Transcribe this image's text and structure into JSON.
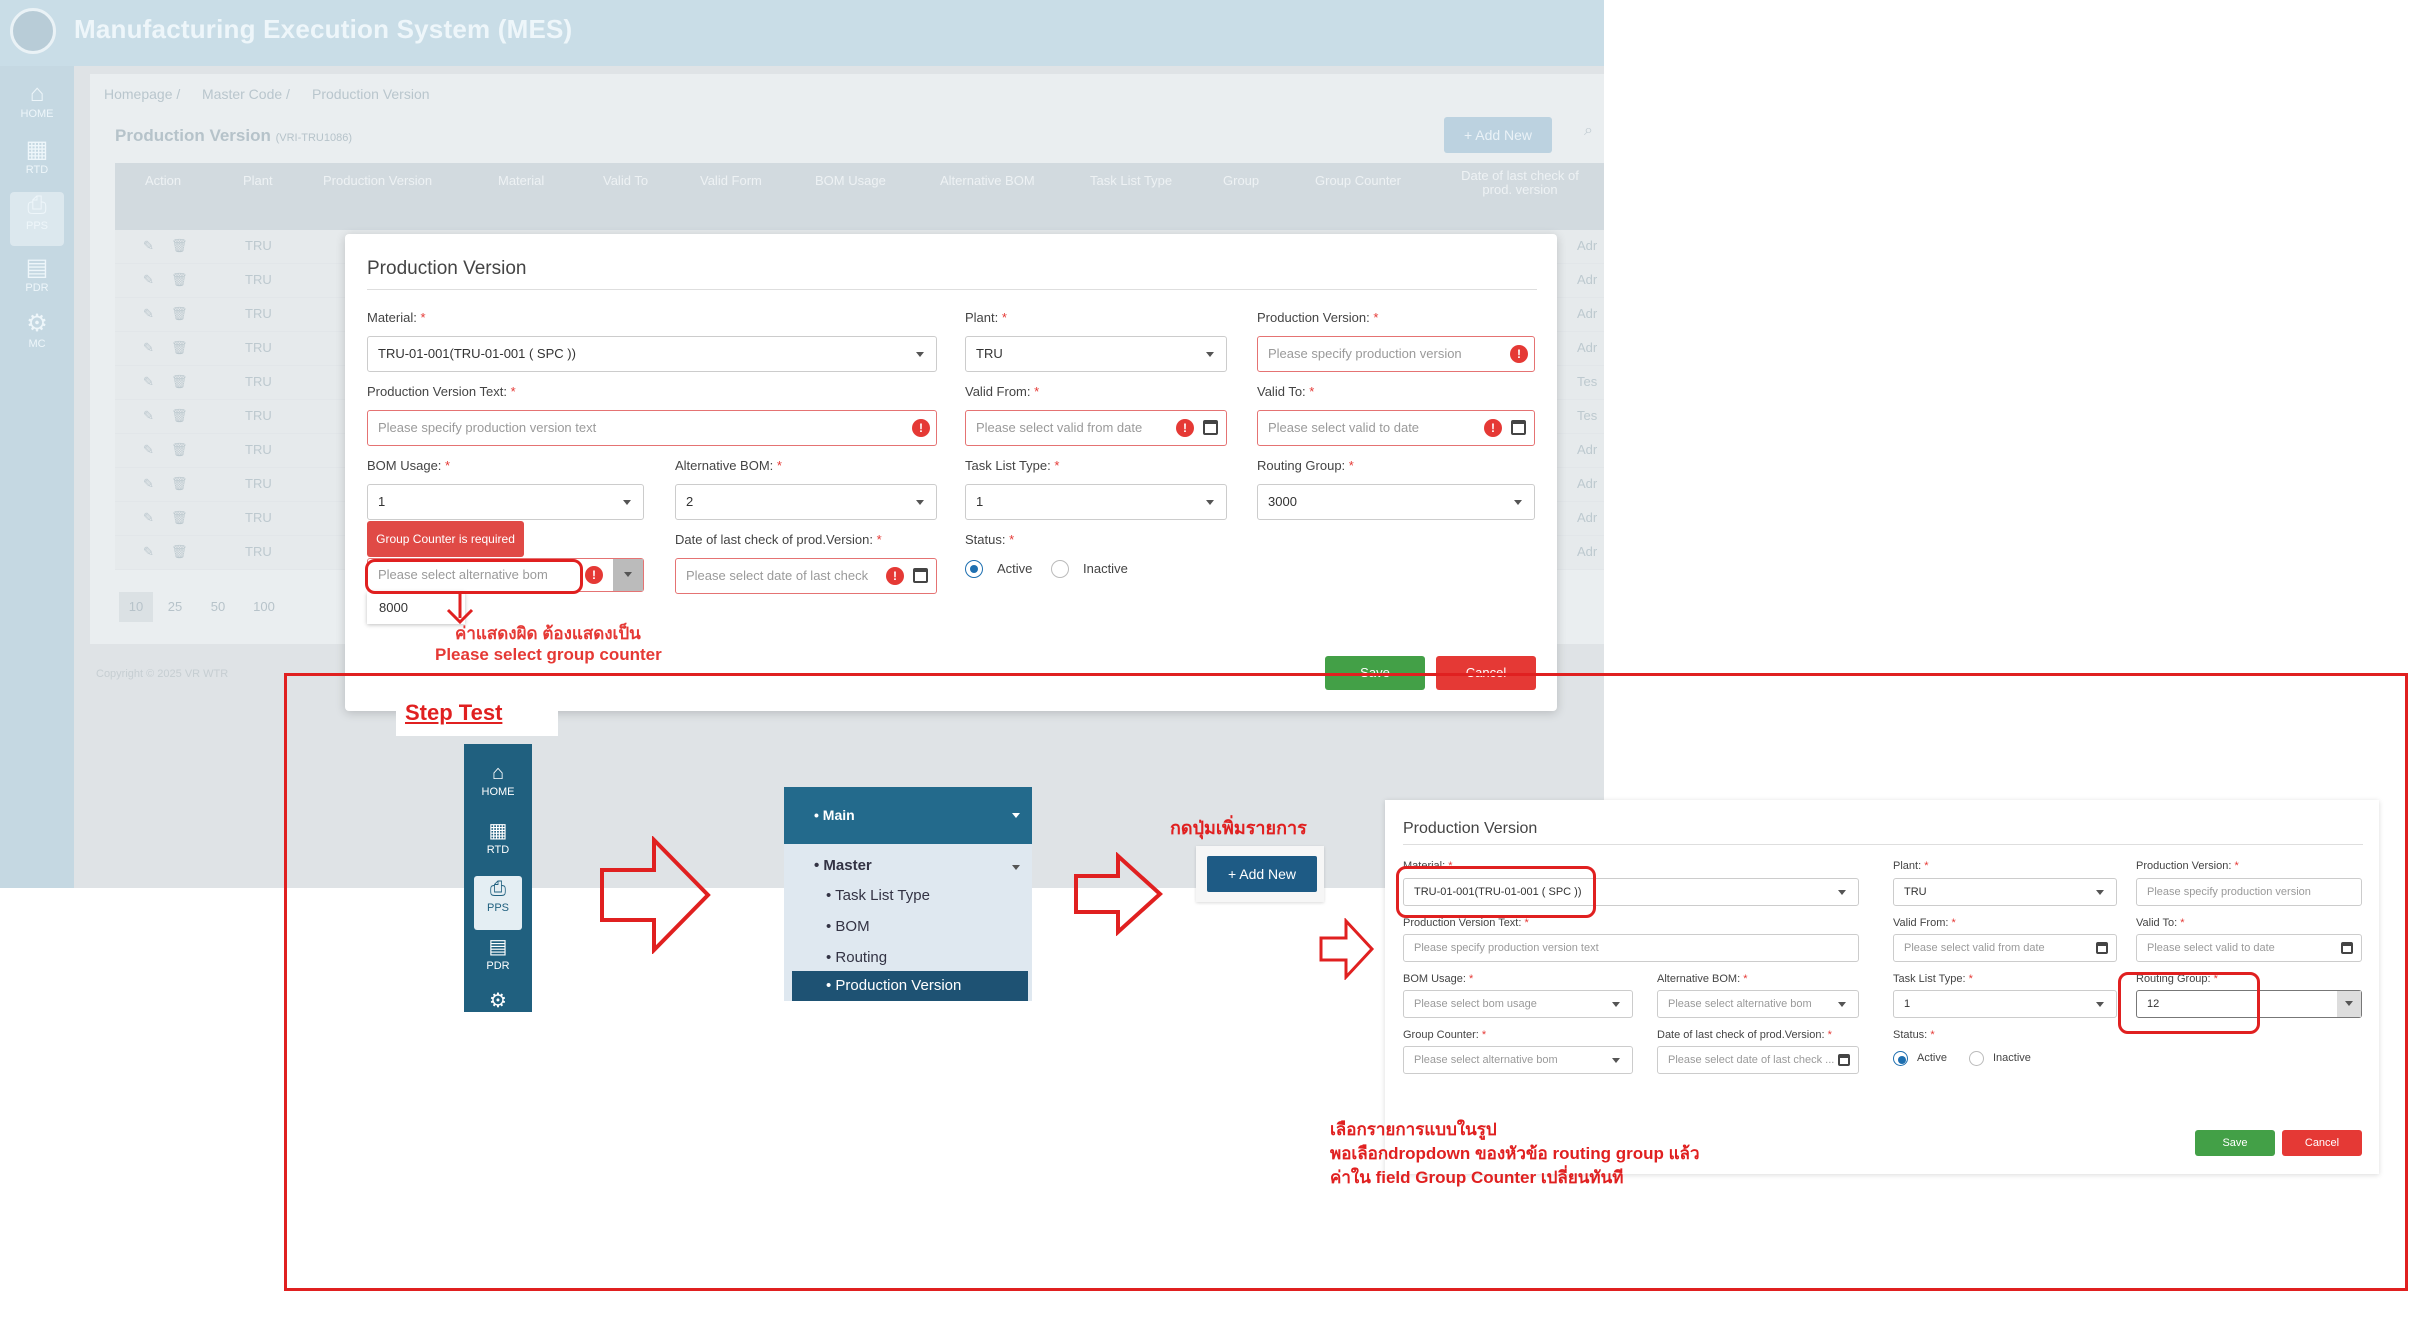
{
  "app": {
    "title": "Manufacturing Execution System (MES)"
  },
  "sidebar": {
    "items": [
      {
        "label": "HOME"
      },
      {
        "label": "RTD"
      },
      {
        "label": "PPS"
      },
      {
        "label": "PDR"
      },
      {
        "label": "MC"
      }
    ]
  },
  "breadcrumb": [
    "Homepage /",
    "Master Code /",
    "Production Version"
  ],
  "page": {
    "title": "Production Version",
    "code": "(VRI-TRU1086)",
    "add_new": "+ Add New"
  },
  "table": {
    "headers": [
      "Action",
      "Plant",
      "Production Version",
      "Material",
      "Valid To",
      "Valid Form",
      "BOM Usage",
      "Alternative BOM",
      "Task List Type",
      "Group",
      "Group Counter",
      "Date of last check of prod. version"
    ],
    "plant_value": "TRU",
    "tail_values": [
      "Adr",
      "Adr",
      "Adr",
      "Adr",
      "Tes",
      "Tes",
      "Adr",
      "Adr",
      "Adr",
      "Adr"
    ]
  },
  "pagination": [
    "10",
    "25",
    "50",
    "100"
  ],
  "footer": {
    "copyright": "Copyright © 2025 VR WTR"
  },
  "modal": {
    "title": "Production Version",
    "material_label": "Material:",
    "material_value": "TRU-01-001(TRU-01-001 ( SPC ))",
    "plant_label": "Plant:",
    "plant_value": "TRU",
    "prodver_label": "Production Version:",
    "prodver_ph": "Please specify production version",
    "pvtext_label": "Production Version Text:",
    "pvtext_ph": "Please specify production version text",
    "validfrom_label": "Valid From:",
    "validfrom_ph": "Please select valid from date",
    "validto_label": "Valid To:",
    "validto_ph": "Please select valid to date",
    "bom_label": "BOM Usage:",
    "bom_value": "1",
    "altbom_label": "Alternative BOM:",
    "altbom_value": "2",
    "tasklist_label": "Task List Type:",
    "tasklist_value": "1",
    "routing_label": "Routing Group:",
    "routing_value": "3000",
    "gc_error": "Group Counter is required",
    "gc_ph": "Please select alternative bom",
    "gc_option": "8000",
    "datecheck_label": "Date of last check of prod.Version:",
    "datecheck_ph": "Please select date of last check",
    "status_label": "Status:",
    "active": "Active",
    "inactive": "Inactive",
    "save": "Save",
    "cancel": "Cancel"
  },
  "annotation": {
    "wrong_line1": "ค่าแสดงผิด ต้องแสดงเป็น",
    "wrong_line2": "Please select  group counter",
    "step_test": "Step Test",
    "press_add": "กดปุ่มเพิ่มรายการ",
    "select_line1": "เลือกรายการแบบในรูป",
    "select_line2": "พอเลือกdropdown ของหัวข้อ routing group แล้ว",
    "select_line3": "ค่าใน field Group Counter เปลี่ยนทันที"
  },
  "menu": {
    "main": "• Main",
    "master": "• Master",
    "items": [
      "• Task List Type",
      "• BOM",
      "• Routing"
    ],
    "active": "• Production Version"
  },
  "add_new2": "+ Add New",
  "modal2": {
    "title": "Production Version",
    "material_label": "Material:",
    "material_value": "TRU-01-001(TRU-01-001 ( SPC ))",
    "plant_label": "Plant:",
    "plant_value": "TRU",
    "prodver_label": "Production Version:",
    "prodver_ph": "Please specify production version",
    "pvtext_label": "Production Version Text:",
    "pvtext_ph": "Please specify production version text",
    "validfrom_label": "Valid From:",
    "validfrom_ph": "Please select valid from date",
    "validto_label": "Valid To:",
    "validto_ph": "Please select valid to date",
    "bom_label": "BOM Usage:",
    "bom_ph": "Please select bom usage",
    "altbom_label": "Alternative BOM:",
    "altbom_ph": "Please select alternative bom",
    "tasklist_label": "Task List Type:",
    "tasklist_value": "1",
    "routing_label": "Routing Group:",
    "routing_value": "12",
    "gc_label": "Group Counter:",
    "gc_ph": "Please select alternative bom",
    "datecheck_label": "Date of last check of prod.Version:",
    "datecheck_ph": "Please select date of last check ...",
    "status_label": "Status:",
    "active": "Active",
    "inactive": "Inactive",
    "save": "Save",
    "cancel": "Cancel"
  },
  "colors": {
    "accent": "#1e6fb0",
    "danger": "#e53935",
    "success": "#43a047",
    "annotation": "#e02020"
  }
}
